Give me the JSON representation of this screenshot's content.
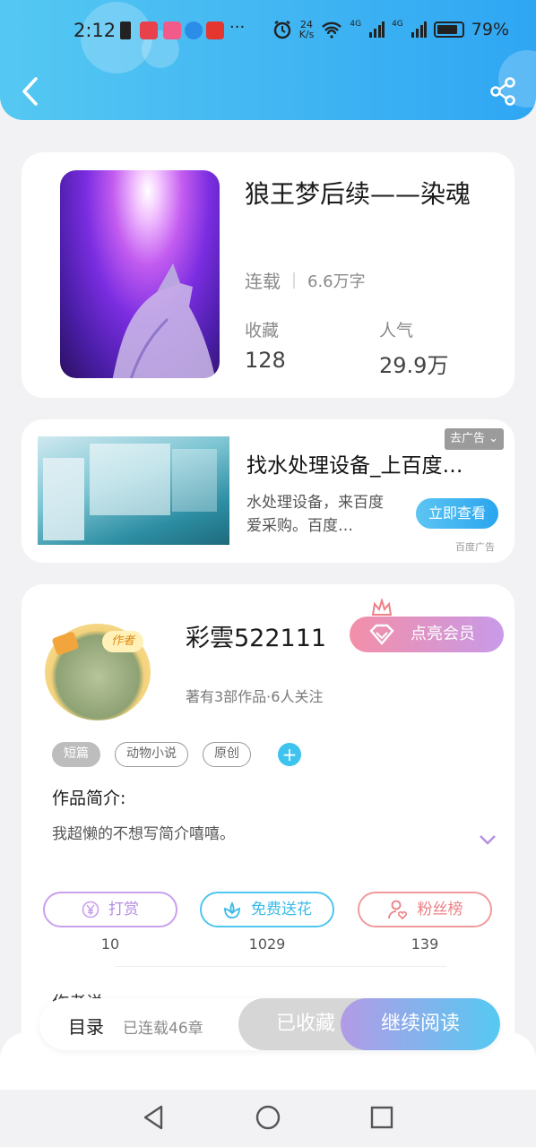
{
  "status_bar": {
    "time": "2:12",
    "more": "···",
    "speed_top": "24",
    "speed_bottom": "K/s",
    "net1": "4G",
    "net2": "4G",
    "battery": "79%"
  },
  "book": {
    "title": "狼王梦后续——染魂",
    "status": "连载",
    "words": "6.6万字",
    "favorites_label": "收藏",
    "favorites": "128",
    "popularity_label": "人气",
    "popularity": "29.9万"
  },
  "ad": {
    "title": "找水处理设备_上百度…",
    "desc": "水处理设备，来百度爱采购。百度…",
    "skip": "去广告",
    "cta": "立即查看",
    "source": "百度广告"
  },
  "author": {
    "badge": "作者",
    "name": "彩雲522111",
    "vip": "点亮会员",
    "stats": "著有3部作品·6人关注",
    "tags": [
      "短篇",
      "动物小说",
      "原创"
    ],
    "tag_add": "+",
    "intro_heading": "作品简介:",
    "intro_text": "我超懒的不想写简介嘻嘻。",
    "actions": [
      {
        "label": "打赏",
        "count": "10"
      },
      {
        "label": "免费送花",
        "count": "1029"
      },
      {
        "label": "粉丝榜",
        "count": "139"
      }
    ],
    "say_heading": "作者说"
  },
  "bottom": {
    "toc": "目录",
    "chapters": "已连载46章",
    "collected": "已收藏",
    "continue": "继续阅读"
  },
  "colors": {
    "header": "#2fa6f3",
    "accent": "#3ec3ef",
    "vip": "#f38fa8",
    "reward": "#c28ee8",
    "flower": "#3ec3ef",
    "fans": "#f07f86"
  },
  "icons": [
    "back-icon",
    "share-icon",
    "alarm-icon",
    "wifi-icon",
    "battery-icon",
    "diamond-icon",
    "crown-icon",
    "yen-icon",
    "flower-icon",
    "fans-icon",
    "chevron-down-icon"
  ]
}
